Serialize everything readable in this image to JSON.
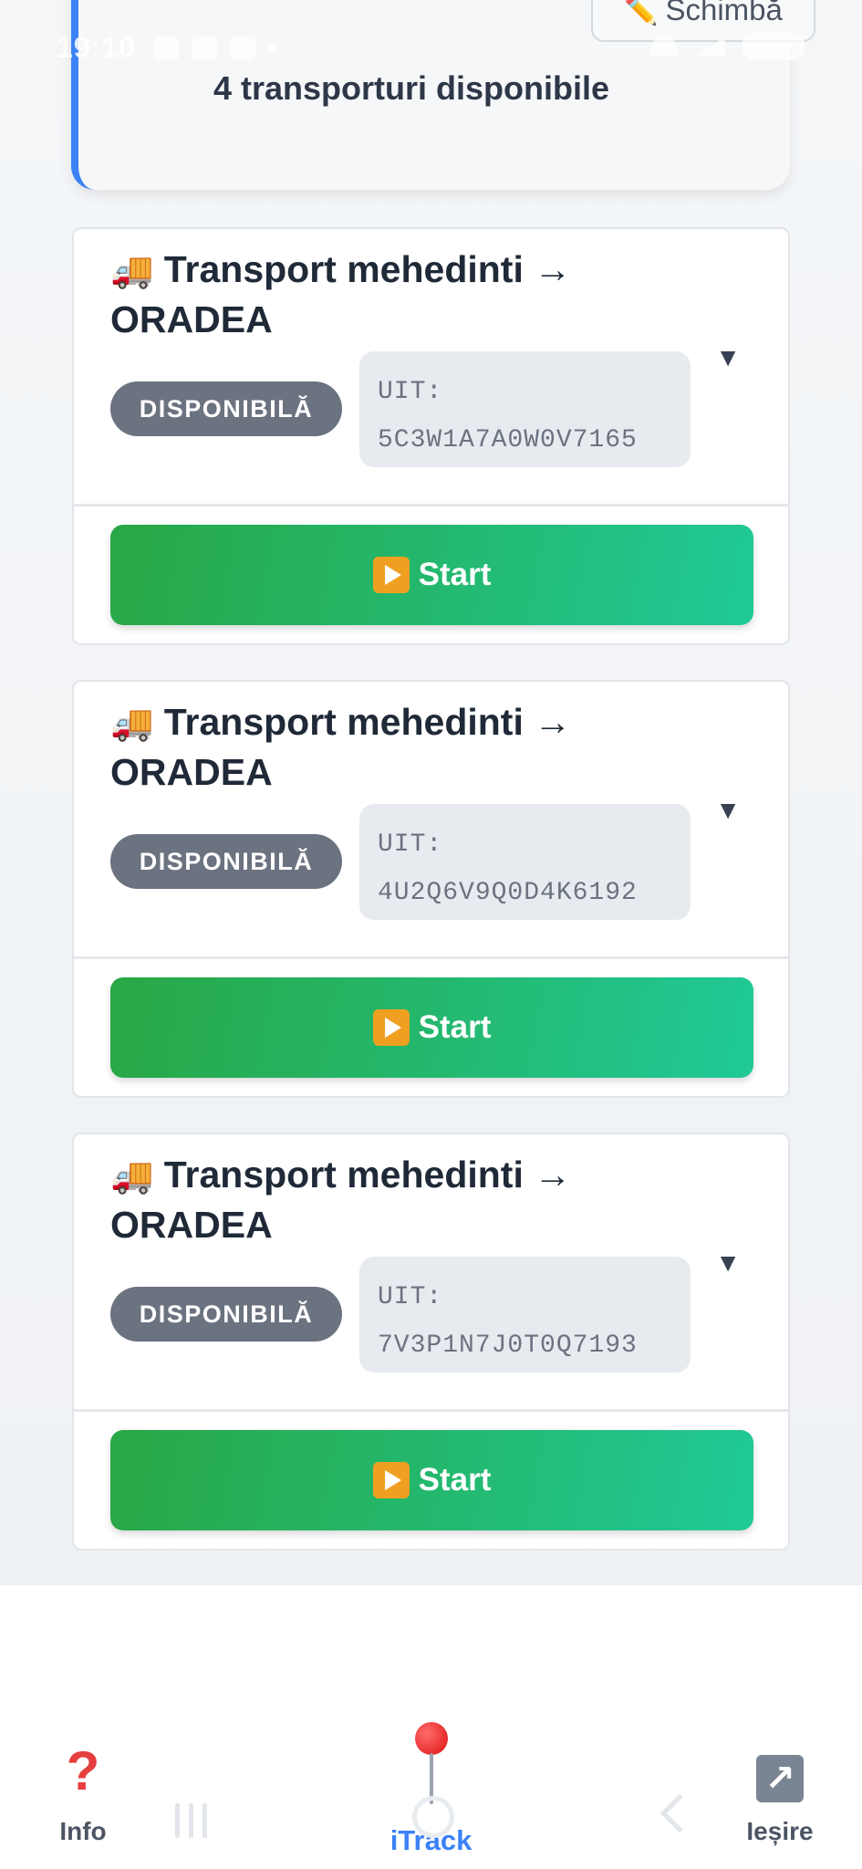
{
  "status_bar": {
    "time": "19:10",
    "battery": "36"
  },
  "header": {
    "change_label": "Schimbă",
    "available_count_text": "4 transporturi disponibile"
  },
  "transports": [
    {
      "title": "Transport mehedinti → ORADEA",
      "status": "DISPONIBILĂ",
      "uit_label": "UIT:",
      "uit_code": "5C3W1A7A0W0V7165",
      "start_label": "Start"
    },
    {
      "title": "Transport mehedinti → ORADEA",
      "status": "DISPONIBILĂ",
      "uit_label": "UIT:",
      "uit_code": "4U2Q6V9Q0D4K6192",
      "start_label": "Start"
    },
    {
      "title": "Transport mehedinti → ORADEA",
      "status": "DISPONIBILĂ",
      "uit_label": "UIT:",
      "uit_code": "7V3P1N7J0T0Q7193",
      "start_label": "Start"
    }
  ],
  "bottom_nav": {
    "info_label": "Info",
    "itrack_label": "iTrack",
    "exit_label": "Ieșire"
  },
  "icons": {
    "transport": "truck-icon",
    "start": "play-icon",
    "expand": "chevron-down-icon",
    "change": "pencil-icon",
    "info": "question-icon",
    "itrack": "pin-icon",
    "exit": "arrow-up-right-icon"
  },
  "colors": {
    "accent": "#3b82f6",
    "start_gradient_from": "#28a745",
    "start_gradient_to": "#20c997",
    "status_badge": "#6b7280"
  }
}
